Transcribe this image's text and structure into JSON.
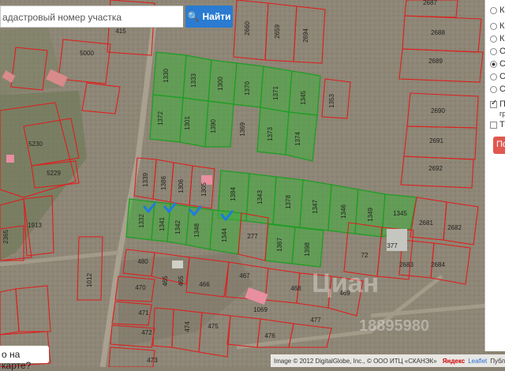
{
  "search": {
    "placeholder": "адастровый номер участка",
    "button_label": "Найти"
  },
  "side_panel": {
    "options": [
      {
        "label": "Ка",
        "selected": false
      },
      {
        "label": "Ка",
        "selected": false
      },
      {
        "label": "Ка",
        "selected": false
      },
      {
        "label": "Ор",
        "selected": false
      },
      {
        "label": "Сп",
        "selected": true
      },
      {
        "label": "Сп",
        "selected": false
      },
      {
        "label": "Сп",
        "selected": false
      },
      {
        "label": "Сп",
        "selected": false
      }
    ],
    "checkbox_1": {
      "label": "П",
      "caption": "гр",
      "checked": true
    },
    "checkbox_2": {
      "label": "Т",
      "checked": false
    },
    "action_label": "По"
  },
  "bottom_prompt": "о на карте?",
  "attribution": {
    "text": "Image © 2012 DigitalGlobe, Inc., © ООО ИТЦ «СКАНЭК»",
    "yandex": "Яндекс",
    "leaflet": "Leaflet",
    "pub": "Публ"
  },
  "watermark": {
    "brand": "Циан",
    "phone": "18895980"
  },
  "colors": {
    "parcel_border": "#e01d1d",
    "highlight_fill": "#3fae3c",
    "highlight_border": "#1f9d26",
    "marker": "#1e7be0",
    "button": "#2a7bd1"
  },
  "parcels": [
    "2687",
    "2688",
    "2689",
    "2690",
    "2691",
    "2692",
    "2681",
    "2682",
    "2683",
    "2684",
    "415",
    "2660",
    "2659",
    "2694",
    "5000",
    "1330",
    "1333",
    "1300",
    "1370",
    "1371",
    "1345",
    "1353",
    "1372",
    "1301",
    "1390",
    "1369",
    "1373",
    "1374",
    "5230",
    "5229",
    "1913",
    "2365",
    "1339",
    "1386",
    "1306",
    "1305",
    "1384",
    "1343",
    "1378",
    "1347",
    "1346",
    "1349",
    "1345",
    "1332",
    "1341",
    "1342",
    "1348",
    "1344",
    "277",
    "1367",
    "1398",
    "72",
    "377",
    "480",
    "465",
    "465",
    "466",
    "467",
    "470",
    "468",
    "469",
    "471",
    "1069",
    "477",
    "472",
    "474",
    "475",
    "476",
    "473",
    "1012"
  ]
}
